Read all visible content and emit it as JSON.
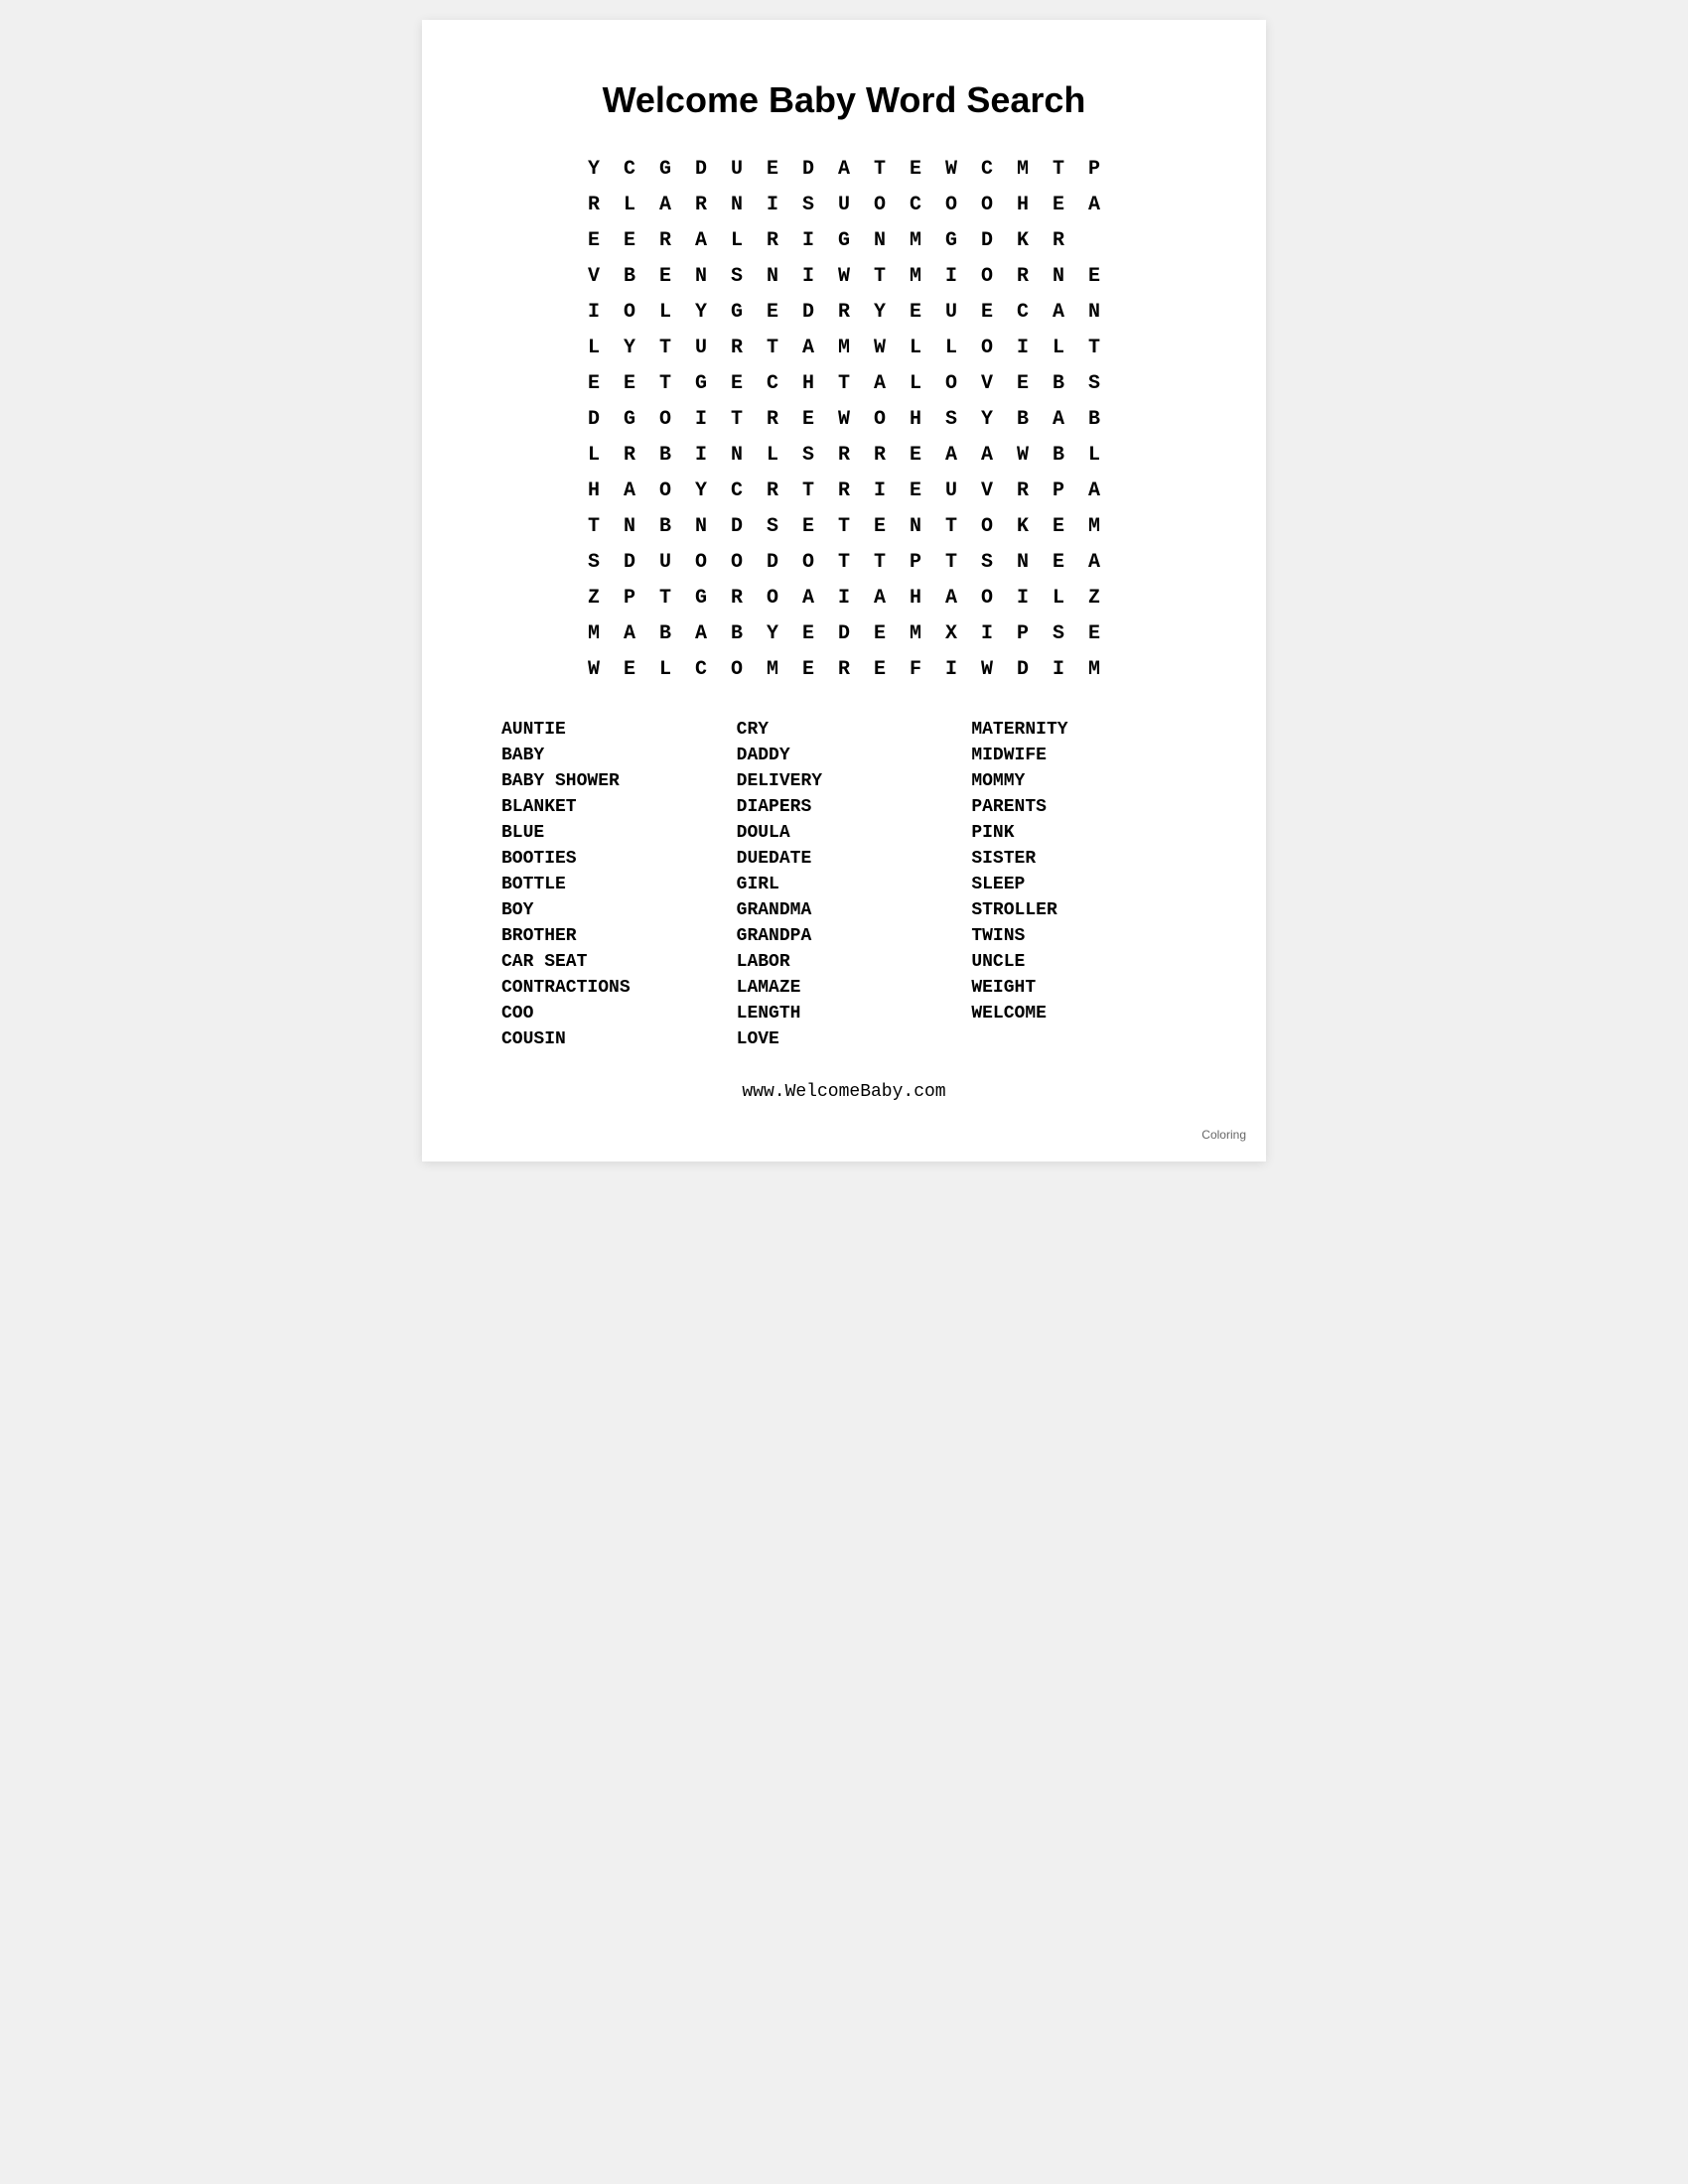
{
  "page": {
    "title": "Welcome Baby Word Search",
    "grid": [
      [
        "Y",
        "C",
        "G",
        "D",
        "U",
        "E",
        "D",
        "A",
        "T",
        "E",
        "W",
        "C",
        "M",
        "T",
        "P"
      ],
      [
        "R",
        "L",
        "A",
        "R",
        "N",
        "I",
        "S",
        "U",
        "O",
        "C",
        "O",
        "O",
        "H",
        "E",
        "A"
      ],
      [
        "E",
        "E",
        "R",
        "A",
        "L",
        "R",
        "I",
        "G",
        "N",
        "M",
        "G",
        "D",
        "K",
        "R",
        ""
      ],
      [
        "V",
        "B",
        "E",
        "N",
        "S",
        "N",
        "I",
        "W",
        "T",
        "M",
        "I",
        "O",
        "R",
        "N",
        "E"
      ],
      [
        "I",
        "O",
        "L",
        "Y",
        "G",
        "E",
        "D",
        "R",
        "Y",
        "E",
        "U",
        "E",
        "C",
        "A",
        "N"
      ],
      [
        "L",
        "Y",
        "T",
        "U",
        "R",
        "T",
        "A",
        "M",
        "W",
        "L",
        "L",
        "O",
        "I",
        "L",
        "T"
      ],
      [
        "E",
        "E",
        "T",
        "G",
        "E",
        "C",
        "H",
        "T",
        "A",
        "L",
        "O",
        "V",
        "E",
        "B",
        "S"
      ],
      [
        "D",
        "G",
        "O",
        "I",
        "T",
        "R",
        "E",
        "W",
        "O",
        "H",
        "S",
        "Y",
        "B",
        "A",
        "B"
      ],
      [
        "L",
        "R",
        "B",
        "I",
        "N",
        "L",
        "S",
        "R",
        "R",
        "E",
        "A",
        "A",
        "W",
        "B",
        "L"
      ],
      [
        "H",
        "A",
        "O",
        "Y",
        "C",
        "R",
        "T",
        "R",
        "I",
        "E",
        "U",
        "V",
        "R",
        "P",
        "A"
      ],
      [
        "T",
        "N",
        "B",
        "N",
        "D",
        "S",
        "E",
        "T",
        "E",
        "N",
        "T",
        "O",
        "K",
        "E",
        "M"
      ],
      [
        "S",
        "D",
        "U",
        "O",
        "O",
        "D",
        "O",
        "T",
        "T",
        "P",
        "T",
        "S",
        "N",
        "E",
        "A"
      ],
      [
        "Z",
        "P",
        "T",
        "G",
        "R",
        "O",
        "A",
        "I",
        "A",
        "H",
        "A",
        "O",
        "I",
        "L",
        "Z"
      ],
      [
        "M",
        "A",
        "B",
        "A",
        "B",
        "Y",
        "E",
        "D",
        "E",
        "M",
        "X",
        "I",
        "P",
        "S",
        "E"
      ],
      [
        "W",
        "E",
        "L",
        "C",
        "O",
        "M",
        "E",
        "R",
        "E",
        "F",
        "I",
        "W",
        "D",
        "I",
        "M"
      ]
    ],
    "words": {
      "col1": [
        "AUNTIE",
        "BABY",
        "BABY SHOWER",
        "BLANKET",
        "BLUE",
        "BOOTIES",
        "BOTTLE",
        "BOY",
        "BROTHER",
        "CAR SEAT",
        "CONTRACTIONS",
        "COO",
        "COUSIN"
      ],
      "col2": [
        "CRY",
        "DADDY",
        "DELIVERY",
        "DIAPERS",
        "DOULA",
        "DUEDATE",
        "GIRL",
        "GRANDMA",
        "GRANDPA",
        "LABOR",
        "LAMAZE",
        "LENGTH",
        "LOVE"
      ],
      "col3": [
        "MATERNITY",
        "MIDWIFE",
        "MOMMY",
        "PARENTS",
        "PINK",
        "SISTER",
        "SLEEP",
        "STROLLER",
        "TWINS",
        "UNCLE",
        "WEIGHT",
        "WELCOME"
      ]
    },
    "footer_url": "www.WelcomeBaby.com",
    "coloring_label": "Coloring"
  }
}
